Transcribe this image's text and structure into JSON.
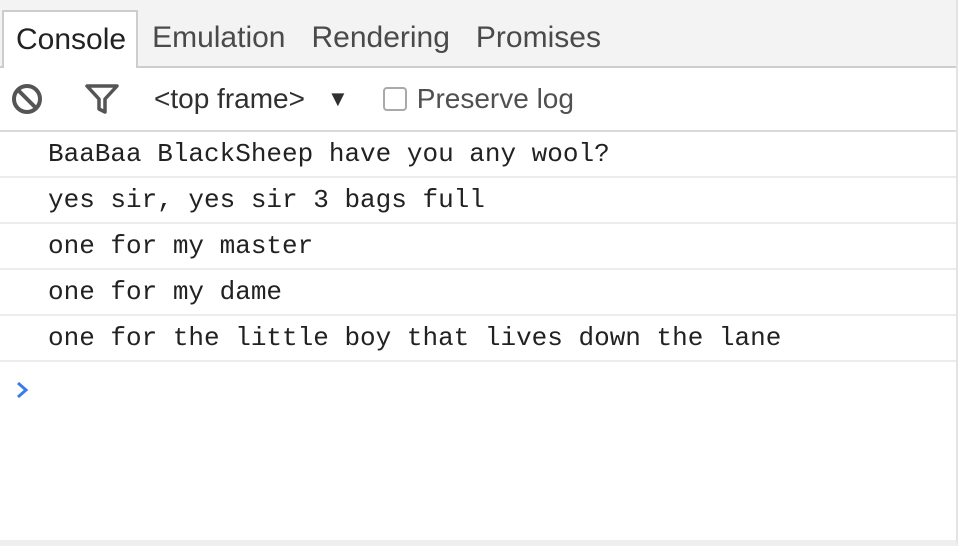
{
  "tabs": [
    {
      "label": "Console",
      "active": true
    },
    {
      "label": "Emulation",
      "active": false
    },
    {
      "label": "Rendering",
      "active": false
    },
    {
      "label": "Promises",
      "active": false
    }
  ],
  "toolbar": {
    "clear_icon": "clear-console-icon",
    "filter_icon": "filter-icon",
    "frame_select_value": "<top frame>",
    "frame_caret": "▼",
    "preserve_log_label": "Preserve log",
    "preserve_log_checked": false
  },
  "messages": [
    "BaaBaa BlackSheep have you any wool?",
    "yes sir, yes sir 3 bags full",
    "one for my master",
    "one for my dame",
    "one for the little boy that lives down the lane"
  ],
  "prompt": {
    "icon": "prompt-chevron-icon",
    "color": "#3b7de8"
  }
}
